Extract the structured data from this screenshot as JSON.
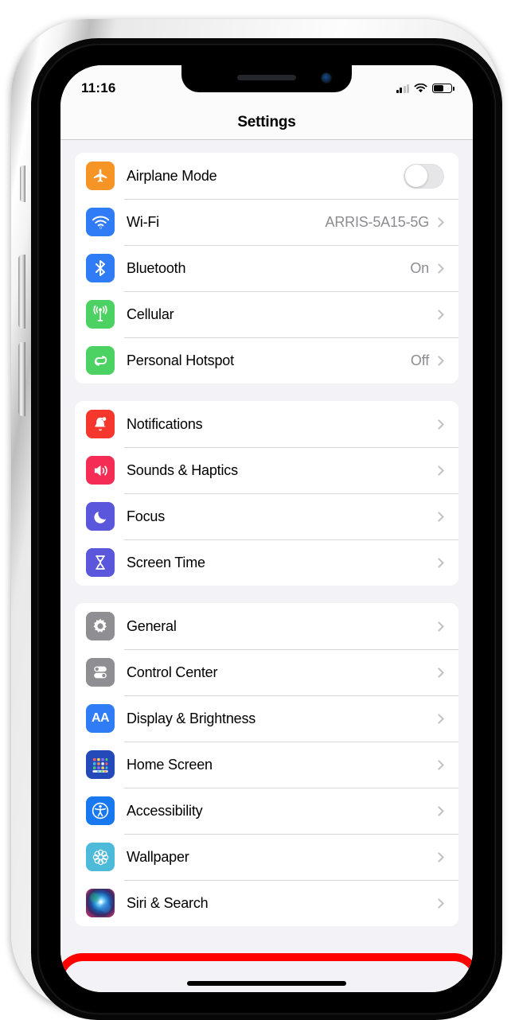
{
  "status_bar": {
    "time": "11:16",
    "signal_icon": "cellular-bars-icon",
    "signal_bars_filled": 2,
    "signal_bars_total": 4,
    "wifi_icon": "wifi-icon",
    "battery_icon": "battery-icon",
    "battery_level_percent": 55
  },
  "header": {
    "title": "Settings"
  },
  "groups": [
    {
      "rows": [
        {
          "icon": "airplane-icon",
          "icon_color": "#f79426",
          "label": "Airplane Mode",
          "value": "",
          "accessory": "toggle",
          "toggle_on": false
        },
        {
          "icon": "wifi-icon",
          "icon_color": "#2f7cf6",
          "label": "Wi-Fi",
          "value": "ARRIS-5A15-5G",
          "accessory": "chevron"
        },
        {
          "icon": "bluetooth-icon",
          "icon_color": "#2f7cf6",
          "label": "Bluetooth",
          "value": "On",
          "accessory": "chevron"
        },
        {
          "icon": "cellular-antenna-icon",
          "icon_color": "#4cd262",
          "label": "Cellular",
          "value": "",
          "accessory": "chevron"
        },
        {
          "icon": "personal-hotspot-icon",
          "icon_color": "#4cd262",
          "label": "Personal Hotspot",
          "value": "Off",
          "accessory": "chevron"
        }
      ]
    },
    {
      "rows": [
        {
          "icon": "notifications-bell-icon",
          "icon_color": "#f6372d",
          "label": "Notifications",
          "value": "",
          "accessory": "chevron"
        },
        {
          "icon": "speaker-volume-icon",
          "icon_color": "#f52d55",
          "label": "Sounds & Haptics",
          "value": "",
          "accessory": "chevron"
        },
        {
          "icon": "focus-moon-icon",
          "icon_color": "#5a57dd",
          "label": "Focus",
          "value": "",
          "accessory": "chevron"
        },
        {
          "icon": "screen-time-hourglass-icon",
          "icon_color": "#5a57dd",
          "label": "Screen Time",
          "value": "",
          "accessory": "chevron"
        }
      ]
    },
    {
      "rows": [
        {
          "icon": "gear-icon",
          "icon_color": "#8e8e93",
          "label": "General",
          "value": "",
          "accessory": "chevron"
        },
        {
          "icon": "control-center-toggles-icon",
          "icon_color": "#8e8e93",
          "label": "Control Center",
          "value": "",
          "accessory": "chevron"
        },
        {
          "icon": "display-brightness-aa-icon",
          "icon_color": "#2f7cf6",
          "label": "Display & Brightness",
          "value": "",
          "accessory": "chevron"
        },
        {
          "icon": "home-screen-grid-icon",
          "icon_color": "#2449b8",
          "label": "Home Screen",
          "value": "",
          "accessory": "chevron"
        },
        {
          "icon": "accessibility-icon",
          "icon_color": "#1878f0",
          "label": "Accessibility",
          "value": "",
          "accessory": "chevron",
          "highlighted": true
        },
        {
          "icon": "wallpaper-flower-icon",
          "icon_color": "#4ebada",
          "label": "Wallpaper",
          "value": "",
          "accessory": "chevron"
        },
        {
          "icon": "siri-orb-icon",
          "icon_color": "#3a2a52",
          "label": "Siri & Search",
          "value": "",
          "accessory": "chevron"
        }
      ]
    }
  ],
  "annotation": {
    "highlight_shape": "oval",
    "highlight_color": "#ff0000",
    "highlight_target": "Accessibility"
  }
}
